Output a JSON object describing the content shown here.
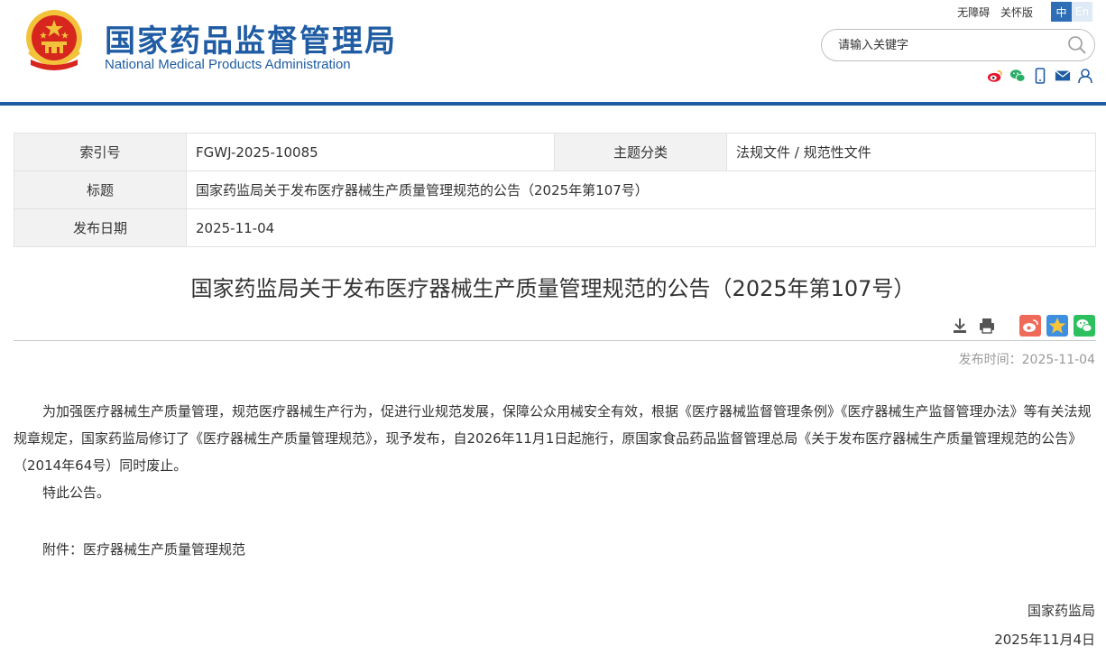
{
  "header": {
    "title_cn": "国家药品监督管理局",
    "title_en": "National Medical Products Administration",
    "top_links": [
      "无障碍",
      "关怀版"
    ],
    "lang": {
      "cn": "中",
      "en": "En"
    },
    "search": {
      "placeholder": "请输入关键字"
    },
    "share_icons": [
      "weibo-icon",
      "wechat-icon",
      "mobile-icon",
      "mail-icon",
      "user-icon"
    ],
    "colors": {
      "brand_blue": "#1f5ca3",
      "emblem_red": "#d7261e",
      "emblem_gold": "#f3c23b"
    }
  },
  "meta": {
    "index_label": "索引号",
    "index_value": "FGWJ-2025-10085",
    "category_label": "主题分类",
    "category_value": "法规文件 / 规范性文件",
    "title_label": "标题",
    "title_value": "国家药监局关于发布医疗器械生产质量管理规范的公告（2025年第107号）",
    "date_label": "发布日期",
    "date_value": "2025-11-04"
  },
  "article": {
    "title": "国家药监局关于发布医疗器械生产质量管理规范的公告（2025年第107号）",
    "tools": [
      "download-icon",
      "print-icon",
      "weibo-share-icon",
      "qzone-share-icon",
      "wechat-share-icon"
    ],
    "pub_time_label": "发布时间：",
    "pub_time": "2025-11-04",
    "paragraph1": "为加强医疗器械生产质量管理，规范医疗器械生产行为，促进行业规范发展，保障公众用械安全有效，根据《医疗器械监督管理条例》《医疗器械生产监督管理办法》等有关法规规章规定，国家药监局修订了《医疗器械生产质量管理规范》，现予发布，自2026年11月1日起施行，原国家食品药品监督管理总局《关于发布医疗器械生产质量管理规范的公告》（2014年64号）同时废止。",
    "paragraph2": "特此公告。",
    "attachment": "附件：医疗器械生产质量管理规范",
    "signature_org": "国家药监局",
    "signature_date": "2025年11月4日"
  }
}
